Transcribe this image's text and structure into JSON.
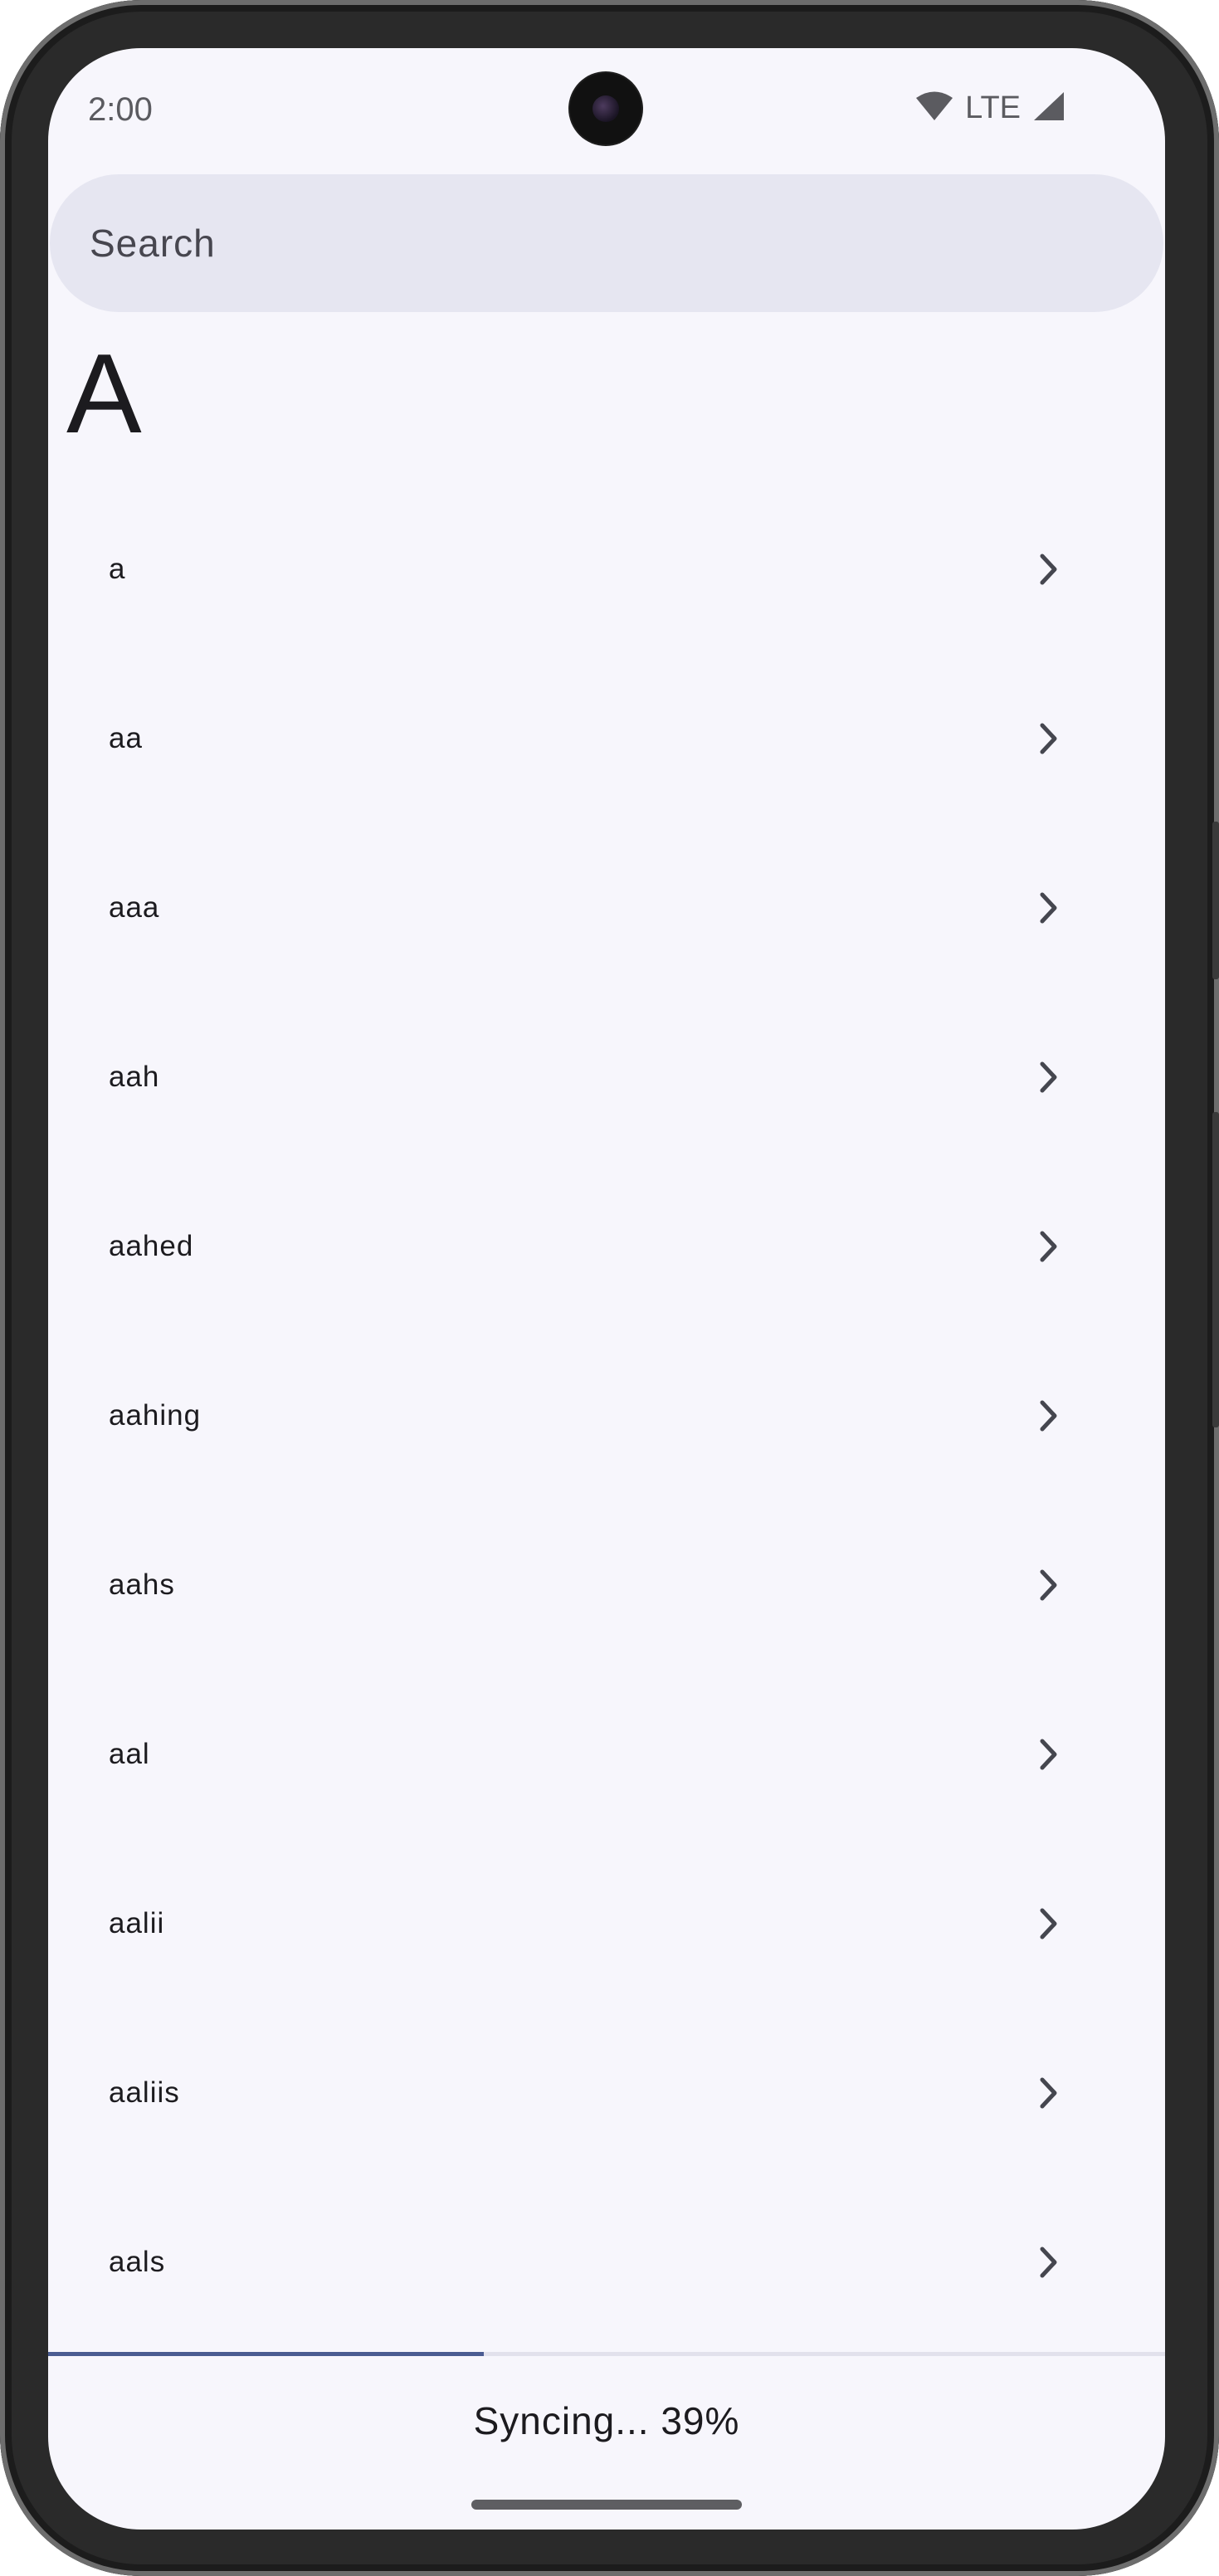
{
  "status_bar": {
    "time": "2:00",
    "network": "LTE",
    "icons": [
      "wifi-icon",
      "signal-icon"
    ]
  },
  "search": {
    "placeholder": "Search"
  },
  "section": {
    "letter": "A"
  },
  "words": [
    "a",
    "aa",
    "aaa",
    "aah",
    "aahed",
    "aahing",
    "aahs",
    "aal",
    "aalii",
    "aaliis",
    "aals"
  ],
  "sync": {
    "label": "Syncing... 39%",
    "progress": 0.39
  },
  "colors": {
    "background": "#f7f6fc",
    "search_bar": "#e6e6f1",
    "progress_fill": "#4b5c92",
    "progress_track": "#e2e1ec",
    "text": "#1c1b1f"
  }
}
